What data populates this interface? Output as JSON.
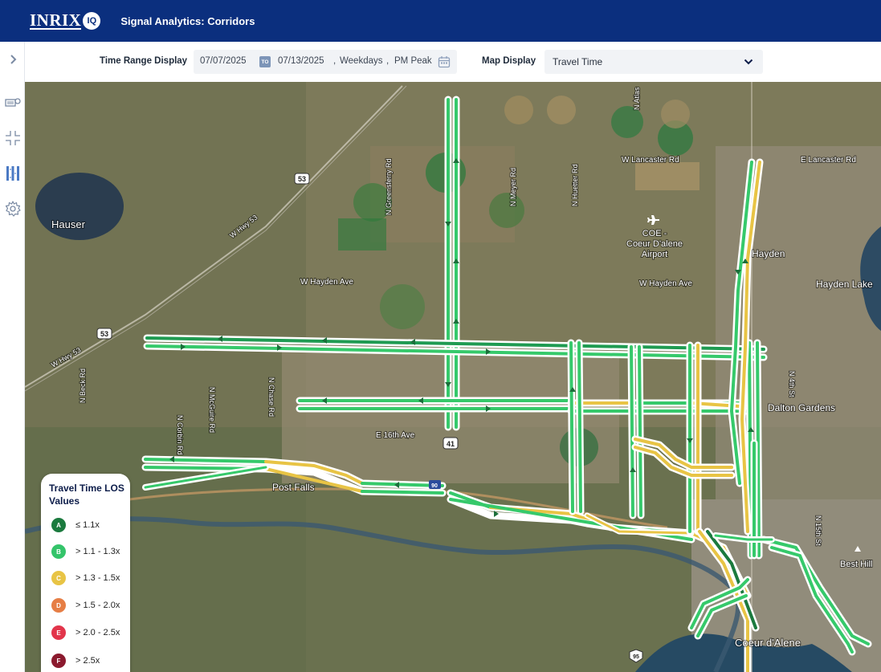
{
  "header": {
    "logo_text": "INRIX",
    "logo_badge": "IQ",
    "app_title": "Signal Analytics: Corridors",
    "bg_color": "#0b2f7e"
  },
  "sidebar": {
    "expand_icon": "chevron-right-icon",
    "items": [
      {
        "icon": "camera-icon"
      },
      {
        "icon": "intersection-icon"
      },
      {
        "icon": "corridor-icon",
        "active": true
      },
      {
        "icon": "gear-icon"
      }
    ]
  },
  "filters": {
    "time_range_label": "Time Range Display",
    "start_date": "07/07/2025",
    "to_badge": "TO",
    "end_date": "07/13/2025",
    "day_type": "Weekdays",
    "period": "PM Peak",
    "map_display_label": "Map Display",
    "map_display_value": "Travel Time"
  },
  "map": {
    "labels": [
      {
        "text": "Hauser"
      },
      {
        "text": "W Hwy 53"
      },
      {
        "text": "W Hwy 53"
      },
      {
        "text": "53"
      },
      {
        "text": "53"
      },
      {
        "text": "N Greensferry Rd"
      },
      {
        "text": "N Meyer Rd"
      },
      {
        "text": "N Huetter Rd"
      },
      {
        "text": "N Atlas"
      },
      {
        "text": "W Lancaster Rd"
      },
      {
        "text": "E Lancaster Rd"
      },
      {
        "text": "COE -"
      },
      {
        "text": "Coeur D'alene"
      },
      {
        "text": "Airport"
      },
      {
        "text": "W Hayden Ave"
      },
      {
        "text": "W Hayden Ave"
      },
      {
        "text": "Hayden"
      },
      {
        "text": "Hayden Lake"
      },
      {
        "text": "N Corbin Rd"
      },
      {
        "text": "N McGuire Rd"
      },
      {
        "text": "N Chase Rd"
      },
      {
        "text": "N Beck Rd"
      },
      {
        "text": "E 16th Ave"
      },
      {
        "text": "41"
      },
      {
        "text": "Dalton Gardens"
      },
      {
        "text": "N 4th St"
      },
      {
        "text": "N 15th St"
      },
      {
        "text": "Post Falls"
      },
      {
        "text": "Best Hill"
      },
      {
        "text": "Coeur d'Alene"
      },
      {
        "text": "95"
      },
      {
        "text": "90"
      }
    ]
  },
  "legend": {
    "title": "Travel Time LOS Values",
    "items": [
      {
        "grade": "A",
        "label": "≤ 1.1x",
        "color": "#1b7a3e"
      },
      {
        "grade": "B",
        "label": "> 1.1 - 1.3x",
        "color": "#34c46a"
      },
      {
        "grade": "C",
        "label": "> 1.3 - 1.5x",
        "color": "#e8c445"
      },
      {
        "grade": "D",
        "label": "> 1.5 - 2.0x",
        "color": "#e67e45"
      },
      {
        "grade": "E",
        "label": "> 2.0 - 2.5x",
        "color": "#e2354b"
      },
      {
        "grade": "F",
        "label": "> 2.5x",
        "color": "#8b1a2e"
      }
    ]
  }
}
